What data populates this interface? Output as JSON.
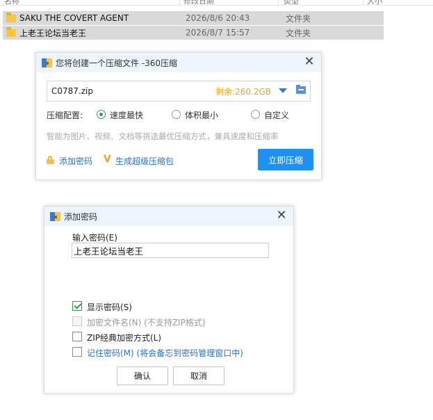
{
  "file_list": {
    "columns": [
      "名称",
      "修改日期",
      "类型",
      "大小"
    ],
    "rows": [
      {
        "name": "SAKU THE COVERT AGENT",
        "date": "2026/8/6 20:43",
        "type": "文件夹"
      },
      {
        "name": "上老王论坛当老王",
        "date": "2026/8/7 15:57",
        "type": "文件夹"
      }
    ]
  },
  "compress_dialog": {
    "title": "您将创建一个压缩文件 -360压缩",
    "filename": "C0787.zip",
    "remaining": "剩余:260.2GB",
    "config_label": "压缩配置:",
    "options": [
      {
        "label": "速度最快",
        "selected": true
      },
      {
        "label": "体积最小",
        "selected": false
      },
      {
        "label": "自定义",
        "selected": false
      }
    ],
    "hint": "智能为图片、视频、文档等挑选最优压缩方式，兼具速度和压缩率",
    "add_password_label": "添加密码",
    "super_pack_label": "生成超级压缩包",
    "compress_button": "立即压缩",
    "icon": "close-icon"
  },
  "password_dialog": {
    "title": "添加密码",
    "input_label": "输入密码(E)",
    "password_value": "上老王论坛当老王",
    "checkboxes": [
      {
        "label": "显示密码(S)",
        "checked": true,
        "enabled": true
      },
      {
        "label": "加密文件名(N) (不支持ZIP格式)",
        "checked": false,
        "enabled": false
      },
      {
        "label": "ZIP经典加密方式(L)",
        "checked": false,
        "enabled": true
      },
      {
        "label": "记住密码(M) (将会备忘到密码管理窗口中)",
        "checked": false,
        "enabled": true
      }
    ],
    "ok_button": "确认",
    "cancel_button": "取消"
  },
  "colors": {
    "accent": "#1f8ff0",
    "link": "#2a70c9",
    "remaining": "#f0a020",
    "selected_row": "#d9d9d9",
    "check_green": "#3a9a5a"
  }
}
